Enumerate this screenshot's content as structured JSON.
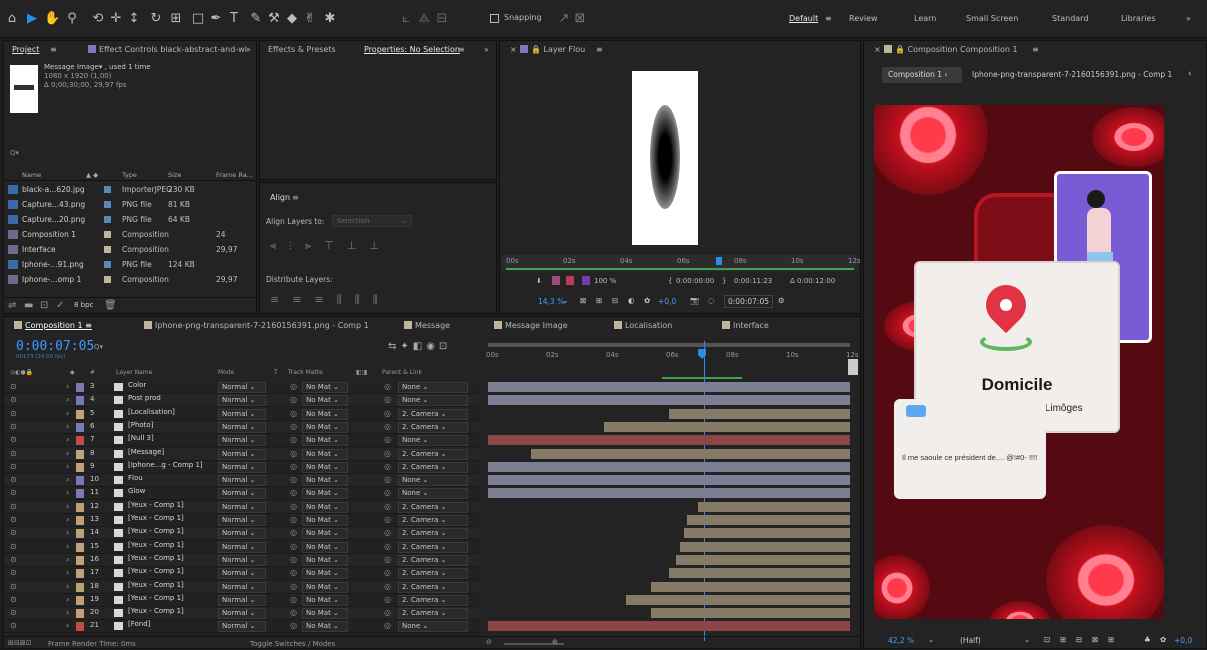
{
  "toolbar": {
    "workspaces": [
      "Default",
      "Review",
      "Learn",
      "Small Screen",
      "Standard",
      "Libraries"
    ],
    "snapping_label": "Snapping",
    "more": "»"
  },
  "project_panel": {
    "tabs": [
      "Project",
      "Effect Controls black-abstract-and-wl",
      "»"
    ],
    "selected_name": "Message Image▾ , used 1 time",
    "selected_dims": "1080 x 1920 (1,00)",
    "selected_duration": "Δ 0;00;30;00, 29,97 fps",
    "search_placeholder": "Q▾",
    "columns": [
      "Name",
      "Type",
      "Size",
      "Frame Ra..."
    ],
    "items": [
      {
        "name": "black-a...620.jpg",
        "type": "ImporterJPEG",
        "size": "230 KB",
        "fps": "",
        "color": "#5b89b5",
        "icon": "image-icon"
      },
      {
        "name": "Capture...43.png",
        "type": "PNG file",
        "size": "81 KB",
        "fps": "",
        "color": "#5b89b5",
        "icon": "image-icon"
      },
      {
        "name": "Capture...20.png",
        "type": "PNG file",
        "size": "64 KB",
        "fps": "",
        "color": "#5b89b5",
        "icon": "image-icon"
      },
      {
        "name": "Composition 1",
        "type": "Composition",
        "size": "",
        "fps": "24",
        "color": "#bfb59a",
        "icon": "comp-icon"
      },
      {
        "name": "Interface",
        "type": "Composition",
        "size": "",
        "fps": "29,97",
        "color": "#bfb59a",
        "icon": "comp-icon"
      },
      {
        "name": "Iphone-...91.png",
        "type": "PNG file",
        "size": "124 KB",
        "fps": "",
        "color": "#5b89b5",
        "icon": "image-icon"
      },
      {
        "name": "Iphone-...omp 1",
        "type": "Composition",
        "size": "",
        "fps": "29,97",
        "color": "#bfb59a",
        "icon": "comp-icon"
      }
    ],
    "bpc": "8 bpc"
  },
  "effects_panel": {
    "tabs": [
      "Effects & Presets",
      "Properties: No Selection",
      "»"
    ]
  },
  "align_panel": {
    "title": "Align",
    "align_to_label": "Align Layers to:",
    "align_to_value": "Selection",
    "distribute_label": "Distribute Layers:"
  },
  "layer_panel": {
    "tab": "Layer Flou",
    "ruler": [
      "00s",
      "02s",
      "04s",
      "06s",
      "08s",
      "10s",
      "12s"
    ],
    "zoom": "100 %",
    "in_point": "0:00:00:00",
    "out_point": "0:00:11:23",
    "duration": "Δ 0:00:12:00",
    "view_zoom": "14,3 %",
    "exposure": "+0,0",
    "current_time": "0:00:07:05"
  },
  "comp_viewer": {
    "title": "Composition Composition 1",
    "breadcrumbs": [
      "Composition 1",
      "Iphone-png-transparent-7-2160156391.png - Comp 1"
    ],
    "card_title": "Domicile",
    "card_subtitle": "25 rue du Moulinel à Limôges",
    "message_text": "Il me saoule ce président de.... @!#0- !!!!",
    "zoom": "42,2 %",
    "resolution": "(Half)",
    "exposure": "+0,0"
  },
  "timeline": {
    "tabs": [
      {
        "label": "Composition 1",
        "color": "#bfb59a"
      },
      {
        "label": "Iphone-png-transparent-7-2160156391.png - Comp 1",
        "color": "#bfb59a"
      },
      {
        "label": "Message",
        "color": "#bfb59a"
      },
      {
        "label": "Message Image",
        "color": "#bfb59a"
      },
      {
        "label": "Localisation",
        "color": "#bfb59a"
      },
      {
        "label": "Interface",
        "color": "#bfb59a"
      }
    ],
    "timecode": "0:00:07:05",
    "frame_info": "00173 (24.00 fps)",
    "search_placeholder": "Q▾",
    "columns": [
      "#",
      "Layer Name",
      "Mode",
      "T",
      "Track Matte",
      "Parent & Link"
    ],
    "ruler": [
      "00s",
      "02s",
      "04s",
      "06s",
      "08s",
      "10s",
      "12s"
    ],
    "layers": [
      {
        "num": "3",
        "name": "Color",
        "mode": "Normal",
        "matte": "No Mat",
        "parent": "None",
        "color": "#7a7ab8",
        "bar_color": "#7d7d93",
        "start": 0.0,
        "end": 1.0
      },
      {
        "num": "4",
        "name": "Post prod",
        "mode": "Normal",
        "matte": "No Mat",
        "parent": "None",
        "color": "#7a7ab8",
        "bar_color": "#7d7d93",
        "start": 0.0,
        "end": 1.0
      },
      {
        "num": "5",
        "name": "[Localisation]",
        "mode": "Normal",
        "matte": "No Mat",
        "parent": "2. Camera",
        "color": "#bfa27a",
        "bar_color": "#857b66",
        "start": 0.5,
        "end": 1.0
      },
      {
        "num": "6",
        "name": "[Photo]",
        "mode": "Normal",
        "matte": "No Mat",
        "parent": "2. Camera",
        "color": "#7a7ab8",
        "bar_color": "#857b66",
        "start": 0.32,
        "end": 1.0
      },
      {
        "num": "7",
        "name": "[Null 3]",
        "mode": "Normal",
        "matte": "No Mat",
        "parent": "None",
        "color": "#c24a4a",
        "bar_color": "#8c4646",
        "start": 0.0,
        "end": 1.0
      },
      {
        "num": "8",
        "name": "[Message]",
        "mode": "Normal",
        "matte": "No Mat",
        "parent": "2. Camera",
        "color": "#bfa27a",
        "bar_color": "#857b66",
        "start": 0.12,
        "end": 1.0
      },
      {
        "num": "9",
        "name": "[Iphone...g - Comp 1]",
        "mode": "Normal",
        "matte": "No Mat",
        "parent": "2. Camera",
        "color": "#bfa27a",
        "bar_color": "#7d7d93",
        "start": 0.0,
        "end": 1.0
      },
      {
        "num": "10",
        "name": "Flou",
        "mode": "Normal",
        "matte": "No Mat",
        "parent": "None",
        "color": "#7a7ab8",
        "bar_color": "#7d7d93",
        "start": 0.0,
        "end": 1.0
      },
      {
        "num": "11",
        "name": "Glow",
        "mode": "Normal",
        "matte": "No Mat",
        "parent": "None",
        "color": "#7a7ab8",
        "bar_color": "#7d7d93",
        "start": 0.0,
        "end": 1.0
      },
      {
        "num": "12",
        "name": "[Yeux - Comp 1]",
        "mode": "Normal",
        "matte": "No Mat",
        "parent": "2. Camera",
        "color": "#bfa27a",
        "bar_color": "#857b66",
        "start": 0.58,
        "end": 1.0
      },
      {
        "num": "13",
        "name": "[Yeux - Comp 1]",
        "mode": "Normal",
        "matte": "No Mat",
        "parent": "2. Camera",
        "color": "#bfa27a",
        "bar_color": "#857b66",
        "start": 0.55,
        "end": 1.0
      },
      {
        "num": "14",
        "name": "[Yeux - Comp 1]",
        "mode": "Normal",
        "matte": "No Mat",
        "parent": "2. Camera",
        "color": "#bfa27a",
        "bar_color": "#857b66",
        "start": 0.54,
        "end": 1.0
      },
      {
        "num": "15",
        "name": "[Yeux - Comp 1]",
        "mode": "Normal",
        "matte": "No Mat",
        "parent": "2. Camera",
        "color": "#bfa27a",
        "bar_color": "#857b66",
        "start": 0.53,
        "end": 1.0
      },
      {
        "num": "16",
        "name": "[Yeux - Comp 1]",
        "mode": "Normal",
        "matte": "No Mat",
        "parent": "2. Camera",
        "color": "#bfa27a",
        "bar_color": "#857b66",
        "start": 0.52,
        "end": 1.0
      },
      {
        "num": "17",
        "name": "[Yeux - Comp 1]",
        "mode": "Normal",
        "matte": "No Mat",
        "parent": "2. Camera",
        "color": "#bfa27a",
        "bar_color": "#857b66",
        "start": 0.5,
        "end": 1.0
      },
      {
        "num": "18",
        "name": "[Yeux - Comp 1]",
        "mode": "Normal",
        "matte": "No Mat",
        "parent": "2. Camera",
        "color": "#bfa27a",
        "bar_color": "#857b66",
        "start": 0.45,
        "end": 1.0
      },
      {
        "num": "19",
        "name": "[Yeux - Comp 1]",
        "mode": "Normal",
        "matte": "No Mat",
        "parent": "2. Camera",
        "color": "#bfa27a",
        "bar_color": "#857b66",
        "start": 0.38,
        "end": 1.0
      },
      {
        "num": "20",
        "name": "[Yeux - Comp 1]",
        "mode": "Normal",
        "matte": "No Mat",
        "parent": "2. Camera",
        "color": "#bfa27a",
        "bar_color": "#857b66",
        "start": 0.45,
        "end": 1.0
      },
      {
        "num": "21",
        "name": "[Fond]",
        "mode": "Normal",
        "matte": "No Mat",
        "parent": "None",
        "color": "#c24a4a",
        "bar_color": "#8c4646",
        "start": 0.0,
        "end": 1.0
      }
    ],
    "footer_render": "Frame Render Time: 0ms",
    "footer_toggle": "Toggle Switches / Modes"
  }
}
